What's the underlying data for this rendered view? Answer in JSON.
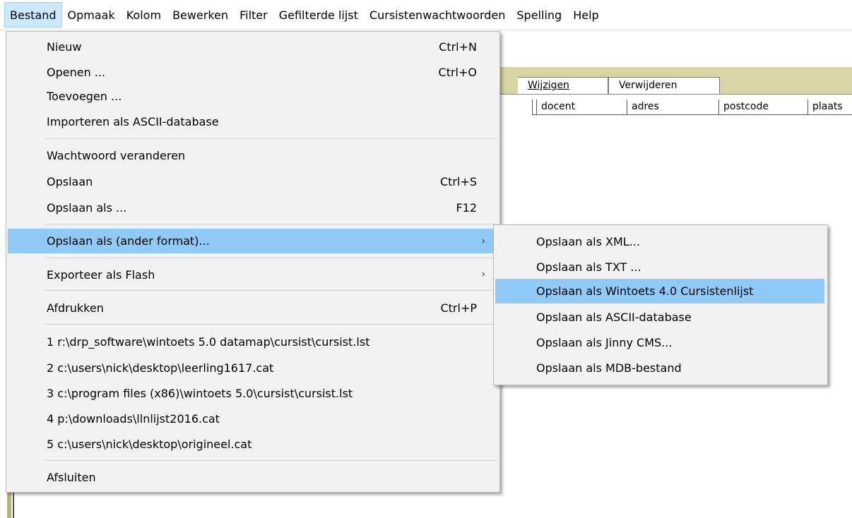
{
  "menubar": {
    "items": [
      "Bestand",
      "Opmaak",
      "Kolom",
      "Bewerken",
      "Filter",
      "Gefilterde lijst",
      "Cursistenwachtwoorden",
      "Spelling",
      "Help"
    ]
  },
  "window": {
    "tabs": [
      "Wijzigen",
      "Verwijderen"
    ],
    "columns": [
      "docent",
      "adres",
      "postcode",
      "plaats"
    ]
  },
  "bestand_menu": {
    "nieuw": {
      "label": "Nieuw",
      "shortcut": "Ctrl+N"
    },
    "openen": {
      "label": "Openen ...",
      "shortcut": "Ctrl+O"
    },
    "toevoegen": {
      "label": "Toevoegen ..."
    },
    "importeren": {
      "label": "Importeren als ASCII-database"
    },
    "wachtwoord": {
      "label": "Wachtwoord veranderen"
    },
    "opslaan": {
      "label": "Opslaan",
      "shortcut": "Ctrl+S"
    },
    "opslaan_als": {
      "label": "Opslaan als ...",
      "shortcut": "F12"
    },
    "opslaan_ander": {
      "label": "Opslaan als (ander format)..."
    },
    "exporteer_flash": {
      "label": "Exporteer als Flash"
    },
    "afdrukken": {
      "label": "Afdrukken",
      "shortcut": "Ctrl+P"
    },
    "recent": [
      "1 r:\\drp_software\\wintoets 5.0 datamap\\cursist\\cursist.lst",
      "2 c:\\users\\nick\\desktop\\leerling1617.cat",
      "3 c:\\program files (x86)\\wintoets 5.0\\cursist\\cursist.lst",
      "4 p:\\downloads\\llnlijst2016.cat",
      "5 c:\\users\\nick\\desktop\\origineel.cat"
    ],
    "afsluiten": {
      "label": "Afsluiten"
    }
  },
  "submenu": {
    "items": [
      "Opslaan als XML...",
      "Opslaan als TXT ...",
      "Opslaan als Wintoets 4.0 Cursistenlijst",
      "Opslaan als ASCII-database",
      "Opslaan als Jinny CMS...",
      "Opslaan als MDB-bestand"
    ]
  },
  "colors": {
    "highlight": "#91c9f7",
    "menubar_active": "#cce8ff",
    "tan": "#d9d4a4"
  }
}
